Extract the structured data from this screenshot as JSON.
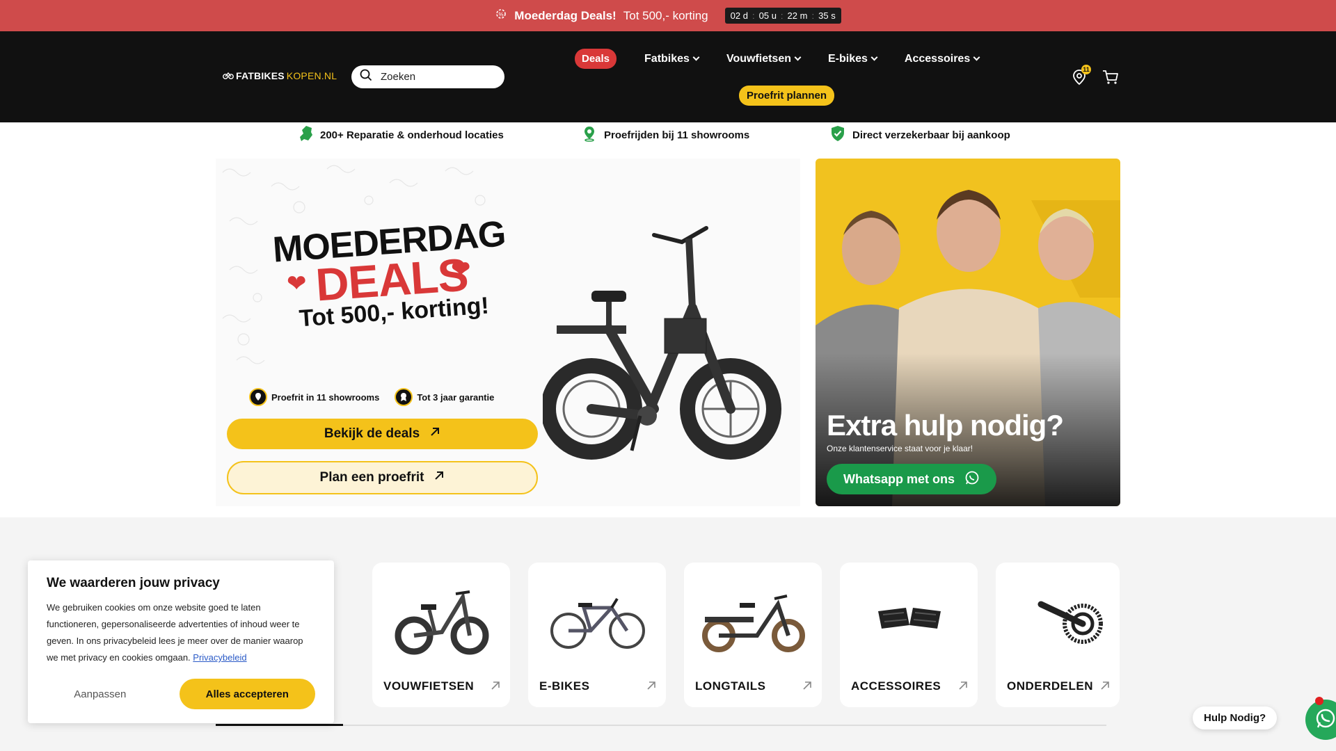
{
  "announcement": {
    "title": "Moederdag Deals!",
    "text": "Tot 500,- korting",
    "countdown": {
      "days": "02",
      "days_unit": "d",
      "hours": "05",
      "hours_unit": "u",
      "minutes": "22",
      "minutes_unit": "m",
      "seconds": "35",
      "seconds_unit": "s"
    }
  },
  "header": {
    "logo_main": "FATBIKES",
    "logo_accent": "KOPEN.NL",
    "search_placeholder": "Zoeken",
    "nav": {
      "deals": "Deals",
      "items": [
        "Fatbikes",
        "Vouwfietsen",
        "E-bikes",
        "Accessoires"
      ],
      "proefrit": "Proefrit plannen"
    },
    "location_badge": "11"
  },
  "usps": [
    "200+ Reparatie & onderhoud locaties",
    "Proefrijden bij 11 showrooms",
    "Direct verzekerbaar bij aankoop"
  ],
  "hero": {
    "line1": "MOEDERDAG",
    "line2": "DEALS",
    "line3": "Tot 500,- korting!",
    "badge1": "Proefrit in 11 showrooms",
    "badge2": "Tot 3 jaar garantie",
    "primary_button": "Bekijk de deals",
    "secondary_button": "Plan een proefrit"
  },
  "help": {
    "title": "Extra hulp nodig?",
    "subtitle": "Onze klantenservice staat voor je klaar!",
    "button": "Whatsapp met ons"
  },
  "categories": [
    "VOUWFIETSEN",
    "E-BIKES",
    "LONGTAILS",
    "ACCESSOIRES",
    "ONDERDELEN"
  ],
  "cookie": {
    "title": "We waarderen jouw privacy",
    "body": "We gebruiken cookies om onze website goed te laten functioneren, gepersonaliseerde advertenties of inhoud weer te geven. In ons privacybeleid lees je meer over de manier waarop we met privacy en cookies omgaan.",
    "link": "Privacybeleid",
    "adjust": "Aanpassen",
    "accept": "Alles accepteren"
  },
  "floating": {
    "help_label": "Hulp Nodig?"
  },
  "colors": {
    "announcement_bg": "#cf4b4b",
    "header_bg": "#111111",
    "accent_yellow": "#f4c21a",
    "deals_red": "#d93838",
    "whatsapp_green": "#1a9a4a"
  },
  "icons": [
    "gear-icon",
    "search-icon",
    "chevron-down-icon",
    "location-icon",
    "cart-icon",
    "map-netherlands-icon",
    "pin-icon",
    "shield-check-icon",
    "arrow-up-right-icon",
    "whatsapp-icon"
  ]
}
